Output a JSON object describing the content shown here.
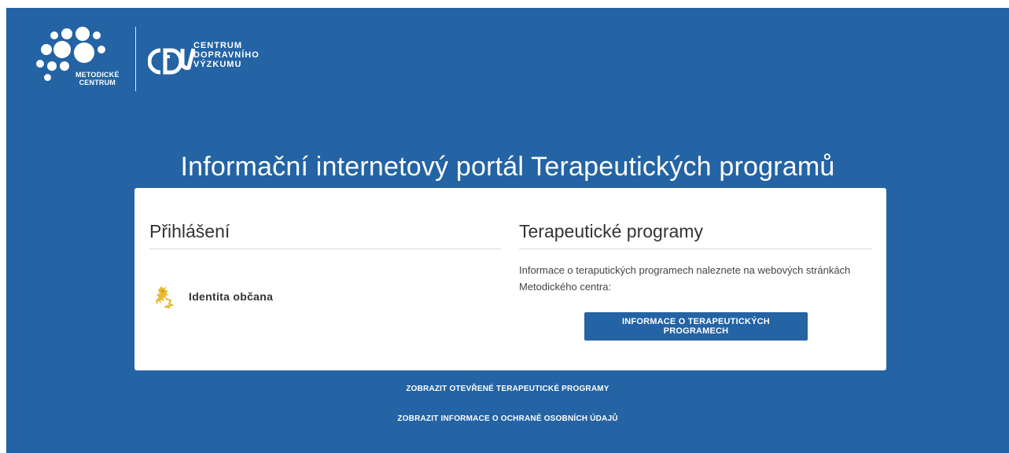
{
  "header": {
    "metodicke_logo_text": [
      "METODICKÉ",
      "CENTRUM"
    ],
    "cdv_logo_text": [
      "CENTRUM",
      "DOPRAVNÍHO",
      "VÝZKUMU"
    ]
  },
  "page_title": "Informační internetový portál Terapeutických programů",
  "login": {
    "heading": "Přihlášení",
    "providers": [
      {
        "label": "Identita občana",
        "icon": "czech-lion-icon"
      }
    ]
  },
  "programs": {
    "heading": "Terapeutické programy",
    "description": "Informace o teraputických programech naleznete na webových stránkách Metodického centra:",
    "button_label": "INFORMACE O TERAPEUTICKÝCH PROGRAMECH"
  },
  "footer": {
    "links": [
      "ZOBRAZIT OTEVŘENÉ TERAPEUTICKÉ PROGRAMY",
      "ZOBRAZIT INFORMACE O OCHRANĚ OSOBNÍCH ÚDAJŮ"
    ]
  },
  "colors": {
    "background": "#2463a4",
    "card": "#ffffff",
    "button": "#2463a4",
    "lion": "#e8b92e"
  }
}
